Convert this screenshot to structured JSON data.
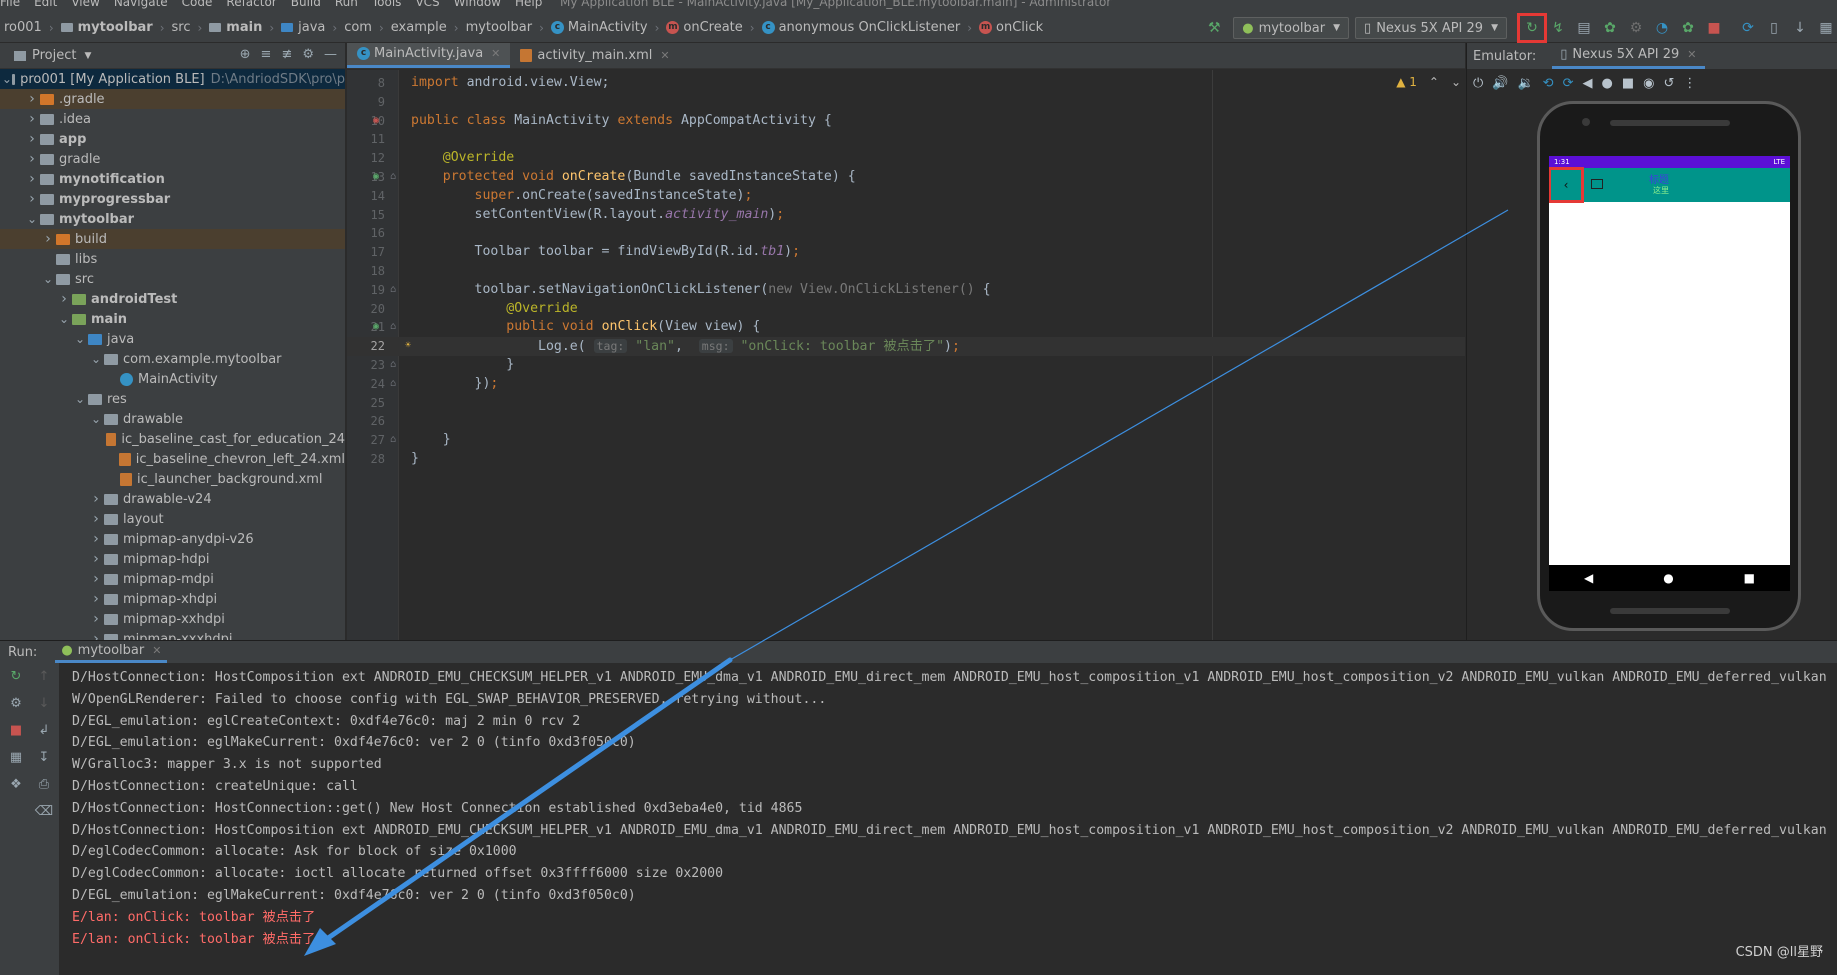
{
  "titlebar": {
    "menu": [
      "File",
      "Edit",
      "View",
      "Navigate",
      "Code",
      "Refactor",
      "Build",
      "Run",
      "Tools",
      "VCS",
      "Window",
      "Help"
    ],
    "window_title": "My Application BLE - MainActivity.java [My_Application_BLE.mytoolbar.main] - Administrator"
  },
  "breadcrumb": {
    "items": [
      "ro001",
      "mytoolbar",
      "src",
      "main",
      "java",
      "com",
      "example",
      "mytoolbar",
      "MainActivity",
      "onCreate",
      "anonymous OnClickListener",
      "onClick"
    ]
  },
  "toolbar": {
    "run_config": "mytoolbar",
    "device": "Nexus 5X API 29"
  },
  "project_panel": {
    "title": "Project",
    "tree": [
      {
        "label": "pro001 [My Application BLE]",
        "suffix": "D:\\AndriodSDK\\pro\\p",
        "depth": 0,
        "icon": "grey",
        "open": true,
        "bold": false,
        "sel": true
      },
      {
        "label": ".gradle",
        "depth": 1,
        "icon": "orange",
        "open": false,
        "hl": true
      },
      {
        "label": ".idea",
        "depth": 1,
        "icon": "grey",
        "open": false
      },
      {
        "label": "app",
        "depth": 1,
        "icon": "grey",
        "open": false,
        "bold": true
      },
      {
        "label": "gradle",
        "depth": 1,
        "icon": "grey",
        "open": false
      },
      {
        "label": "mynotification",
        "depth": 1,
        "icon": "grey",
        "open": false,
        "bold": true
      },
      {
        "label": "myprogressbar",
        "depth": 1,
        "icon": "grey",
        "open": false,
        "bold": true
      },
      {
        "label": "mytoolbar",
        "depth": 1,
        "icon": "grey",
        "open": true,
        "bold": true
      },
      {
        "label": "build",
        "depth": 2,
        "icon": "orange",
        "open": false,
        "hl": true
      },
      {
        "label": "libs",
        "depth": 2,
        "icon": "grey",
        "leaf": true
      },
      {
        "label": "src",
        "depth": 2,
        "icon": "grey",
        "open": true
      },
      {
        "label": "androidTest",
        "depth": 3,
        "icon": "green",
        "open": false,
        "bold": true
      },
      {
        "label": "main",
        "depth": 3,
        "icon": "green",
        "open": true,
        "bold": true
      },
      {
        "label": "java",
        "depth": 4,
        "icon": "blue",
        "open": true
      },
      {
        "label": "com.example.mytoolbar",
        "depth": 5,
        "icon": "grey",
        "open": true
      },
      {
        "label": "MainActivity",
        "depth": 6,
        "icon": "class",
        "leaf": true
      },
      {
        "label": "res",
        "depth": 4,
        "icon": "grey",
        "open": true
      },
      {
        "label": "drawable",
        "depth": 5,
        "icon": "grey",
        "open": true
      },
      {
        "label": "ic_baseline_cast_for_education_24",
        "depth": 6,
        "icon": "file",
        "leaf": true
      },
      {
        "label": "ic_baseline_chevron_left_24.xml",
        "depth": 6,
        "icon": "file",
        "leaf": true
      },
      {
        "label": "ic_launcher_background.xml",
        "depth": 6,
        "icon": "file",
        "leaf": true
      },
      {
        "label": "drawable-v24",
        "depth": 5,
        "icon": "grey",
        "open": false
      },
      {
        "label": "layout",
        "depth": 5,
        "icon": "grey",
        "open": false
      },
      {
        "label": "mipmap-anydpi-v26",
        "depth": 5,
        "icon": "grey",
        "open": false
      },
      {
        "label": "mipmap-hdpi",
        "depth": 5,
        "icon": "grey",
        "open": false
      },
      {
        "label": "mipmap-mdpi",
        "depth": 5,
        "icon": "grey",
        "open": false
      },
      {
        "label": "mipmap-xhdpi",
        "depth": 5,
        "icon": "grey",
        "open": false
      },
      {
        "label": "mipmap-xxhdpi",
        "depth": 5,
        "icon": "grey",
        "open": false
      },
      {
        "label": "mipmap-xxxhdpi",
        "depth": 5,
        "icon": "grey",
        "open": false
      }
    ]
  },
  "editor": {
    "tabs": [
      "MainActivity.java",
      "activity_main.xml"
    ],
    "warning_count": "1",
    "current_line": 22,
    "lines": [
      {
        "n": 8,
        "segs": [
          [
            "kw",
            "import "
          ],
          [
            "cls",
            "android.view.View;"
          ]
        ]
      },
      {
        "n": 9,
        "segs": []
      },
      {
        "n": 10,
        "segs": [
          [
            "kw",
            "public class "
          ],
          [
            "cls",
            "MainActivity "
          ],
          [
            "kw",
            "extends "
          ],
          [
            "cls",
            "AppCompatActivity {"
          ]
        ]
      },
      {
        "n": 11,
        "segs": []
      },
      {
        "n": 12,
        "segs": [
          [
            "cls",
            "    "
          ],
          [
            "ann",
            "@Override"
          ]
        ]
      },
      {
        "n": 13,
        "segs": [
          [
            "kw",
            "    protected void "
          ],
          [
            "fn",
            "onCreate"
          ],
          [
            "cls",
            "(Bundle savedInstanceState) {"
          ]
        ]
      },
      {
        "n": 14,
        "segs": [
          [
            "kw",
            "        super"
          ],
          [
            "cls",
            "."
          ],
          [
            "cls",
            "onCreate(savedInstanceState)"
          ],
          [
            "kw",
            ";"
          ]
        ]
      },
      {
        "n": 15,
        "segs": [
          [
            "cls",
            "        setContentView(R.layout."
          ],
          [
            "ital",
            "activity_main"
          ],
          [
            "cls",
            ")"
          ],
          [
            "kw",
            ";"
          ]
        ]
      },
      {
        "n": 16,
        "segs": []
      },
      {
        "n": 17,
        "segs": [
          [
            "cls",
            "        Toolbar toolbar = findViewById(R.id."
          ],
          [
            "ital",
            "tb1"
          ],
          [
            "cls",
            ")"
          ],
          [
            "kw",
            ";"
          ]
        ]
      },
      {
        "n": 18,
        "segs": []
      },
      {
        "n": 19,
        "segs": [
          [
            "cls",
            "        toolbar.setNavigationOnClickListener("
          ],
          [
            "grey",
            "new View.OnClickListener() "
          ],
          [
            "cls",
            "{"
          ]
        ]
      },
      {
        "n": 20,
        "segs": [
          [
            "cls",
            "            "
          ],
          [
            "ann",
            "@Override"
          ]
        ]
      },
      {
        "n": 21,
        "segs": [
          [
            "kw",
            "            public void "
          ],
          [
            "fn",
            "onClick"
          ],
          [
            "cls",
            "(View view) {"
          ]
        ]
      },
      {
        "n": 22,
        "segs": [
          [
            "cls",
            "                Log.e( "
          ],
          [
            "hint",
            "tag:"
          ],
          [
            "str",
            " \"lan\""
          ],
          [
            "cls",
            ",  "
          ],
          [
            "hint",
            "msg:"
          ],
          [
            "str",
            " \"onClick: toolbar 被点击了\""
          ],
          [
            "cls",
            ")"
          ],
          [
            "kw",
            ";"
          ]
        ]
      },
      {
        "n": 23,
        "segs": [
          [
            "cls",
            "            }"
          ]
        ]
      },
      {
        "n": 24,
        "segs": [
          [
            "cls",
            "        })"
          ],
          [
            "kw",
            ";"
          ]
        ]
      },
      {
        "n": 25,
        "segs": []
      },
      {
        "n": 26,
        "segs": []
      },
      {
        "n": 27,
        "segs": [
          [
            "cls",
            "    }"
          ]
        ]
      },
      {
        "n": 28,
        "segs": [
          [
            "cls",
            "}"
          ]
        ]
      }
    ]
  },
  "emulator": {
    "label": "Emulator:",
    "tab": "Nexus 5X API 29",
    "status_time": "1:31",
    "status_right": "LTE",
    "app_title": "标题",
    "app_subtitle": "这里"
  },
  "run": {
    "label": "Run:",
    "tab": "mytoolbar",
    "log": [
      {
        "t": "D/HostConnection: HostComposition ext ANDROID_EMU_CHECKSUM_HELPER_v1 ANDROID_EMU_dma_v1 ANDROID_EMU_direct_mem ANDROID_EMU_host_composition_v1 ANDROID_EMU_host_composition_v2 ANDROID_EMU_vulkan ANDROID_EMU_deferred_vulkan",
        "err": false
      },
      {
        "t": "W/OpenGLRenderer: Failed to choose config with EGL_SWAP_BEHAVIOR_PRESERVED, retrying without...",
        "err": false
      },
      {
        "t": "D/EGL_emulation: eglCreateContext: 0xdf4e76c0: maj 2 min 0 rcv 2",
        "err": false
      },
      {
        "t": "D/EGL_emulation: eglMakeCurrent: 0xdf4e76c0: ver 2 0 (tinfo 0xd3f050c0)",
        "err": false
      },
      {
        "t": "W/Gralloc3: mapper 3.x is not supported",
        "err": false
      },
      {
        "t": "D/HostConnection: createUnique: call",
        "err": false
      },
      {
        "t": "D/HostConnection: HostConnection::get() New Host Connection established 0xd3eba4e0, tid 4865",
        "err": false
      },
      {
        "t": "D/HostConnection: HostComposition ext ANDROID_EMU_CHECKSUM_HELPER_v1 ANDROID_EMU_dma_v1 ANDROID_EMU_direct_mem ANDROID_EMU_host_composition_v1 ANDROID_EMU_host_composition_v2 ANDROID_EMU_vulkan ANDROID_EMU_deferred_vulkan",
        "err": false
      },
      {
        "t": "D/eglCodecCommon: allocate: Ask for block of size 0x1000",
        "err": false
      },
      {
        "t": "D/eglCodecCommon: allocate: ioctl allocate returned offset 0x3ffff6000 size 0x2000",
        "err": false
      },
      {
        "t": "D/EGL_emulation: eglMakeCurrent: 0xdf4e76c0: ver 2 0 (tinfo 0xd3f050c0)",
        "err": false
      },
      {
        "t": "E/lan: onClick: toolbar 被点击了",
        "err": true
      },
      {
        "t": "E/lan: onClick: toolbar 被点击了",
        "err": true
      }
    ]
  },
  "watermark": "CSDN @ll星野",
  "colors": {
    "accent": "#4a88c7",
    "annotation_red": "#e53935",
    "arrow": "#3d8fe0",
    "toolbar_teal": "#00948a",
    "statusbar": "#5c0fd6"
  }
}
